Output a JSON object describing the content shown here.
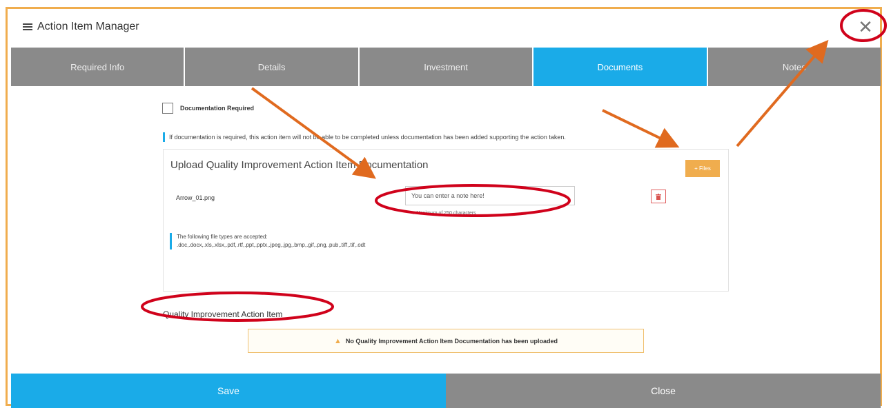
{
  "window": {
    "title": "Action Item Manager",
    "title_icon": "list-icon",
    "close_icon": "close-icon",
    "close_glyph": "✕"
  },
  "tabs": [
    {
      "label": "Required Info",
      "active": false
    },
    {
      "label": "Details",
      "active": false
    },
    {
      "label": "Investment",
      "active": false
    },
    {
      "label": "Documents",
      "active": true
    },
    {
      "label": "Notes",
      "active": false
    }
  ],
  "documents": {
    "checkbox_label": "Documentation Required",
    "checkbox_checked": false,
    "info_text": "If documentation is required, this action item will not be able to be completed unless documentation has been added supporting the action taken.",
    "upload_title": "Upload Quality Improvement Action Item Documentation",
    "files_button": "+ Files",
    "file": {
      "name": "Arrow_01.png",
      "note_placeholder": "You can enter a note here!",
      "max_note": "Maximum of 250 characters",
      "delete_icon": "trash-icon"
    },
    "filetypes_heading": "The following file types are accepted:",
    "filetypes_list": ".doc,.docx,.xls,.xlsx,.pdf,.rtf,.ppt,.pptx,.jpeg,.jpg,.bmp,.gif,.png,.pub,.tiff,.tif,.odt",
    "section_title": "Quality Improvement Action Item",
    "warning_icon": "warning-icon",
    "warning_text": "No Quality Improvement Action Item Documentation has been uploaded"
  },
  "footer": {
    "save_label": "Save",
    "close_label": "Close"
  },
  "colors": {
    "accent": "#1aabe8",
    "tab_inactive": "#8a8a8a",
    "orange": "#f0ad4e",
    "annotation_red": "#d0021b",
    "annotation_arrow": "#e06a1f"
  }
}
